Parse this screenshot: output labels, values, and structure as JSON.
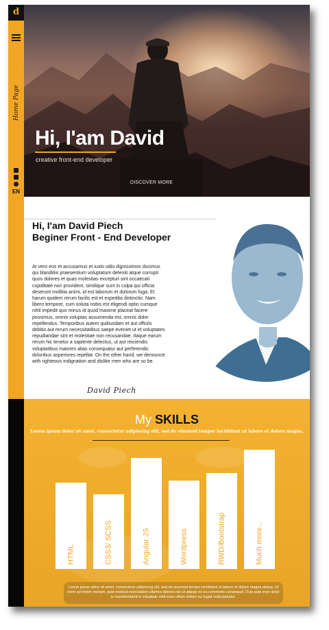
{
  "sidebar": {
    "logo": "d",
    "home_label": "Home Page",
    "social_icons": [
      "youtube-icon",
      "linkedin-icon",
      "github-icon"
    ],
    "lang": "EN"
  },
  "hero": {
    "title": "Hi, I'am David",
    "subtitle": "creative front-end developer",
    "discover": "DISCOVER MORE"
  },
  "about": {
    "title_line1": "Hi, I'am David Piech",
    "title_line2": "Beginer Front - End Developer",
    "body": "At vero eos et accusamus et iusto odio dignissimos ducimus qui blanditiis praesentium voluptatum deleniti atque corrupti quos dolores et quas molestias excepturi sint occaecati cupiditate non provident, similique sunt in culpa qui officia deserunt mollitia animi, id est laborum et dolorum fuga. Et harum quidem rerum facilis est et expedita distinctio. Nam libero tempore, cum soluta nobis est eligendi optio cumque nihil impedit quo minus id quod maxime placeat facere possimus, omnis voluptas assumenda est, omnis dolor repellendus. Temporibus autem quibusdam et aut officiis debitis aut rerum necessitatibus saepe eveniet ut et voluptates repudiandae sint et molestiae non recusandae. Itaque earum rerum hic tenetur a sapiente delectus, ut aut reiciendis voluptatibus maiores alias consequatur aut perferendis doloribus asperiores repellat. On the other hand, we denounce with righteous indignation and dislike men who are so be.",
    "signature": "David Piech"
  },
  "skills": {
    "title_my": "My",
    "title_skills": "SKILLS",
    "subtitle": "Lorem ipsum dolor sit amet, consectetur adipiscing elit, sed do eiusmod tempor incididunt ut labore et dolore magna.",
    "footer": "Lorem ipsum dolor sit amet, consectetur adipiscing elit, sed do eiusmod tempor incididunt ut labore et dolore magna aliqua. Ut enim ad minim veniam, quis nostrud exercitation ullamco laboris nisi ut aliquip ex ea commodo consequat. Duis aute irure dolor in reprehenderit in voluptate velit esse cillum dolore eu fugiat nulla pariatur.",
    "accent": "#f2a623"
  },
  "chart_data": {
    "type": "bar",
    "categories": [
      "HTML",
      "CSS3/ SCSS",
      "Angular JS",
      "Wordpress",
      "RWD/Bootstrap",
      "Much more..."
    ],
    "values": [
      0.45,
      0.39,
      0.58,
      0.46,
      0.5,
      0.62
    ]
  }
}
